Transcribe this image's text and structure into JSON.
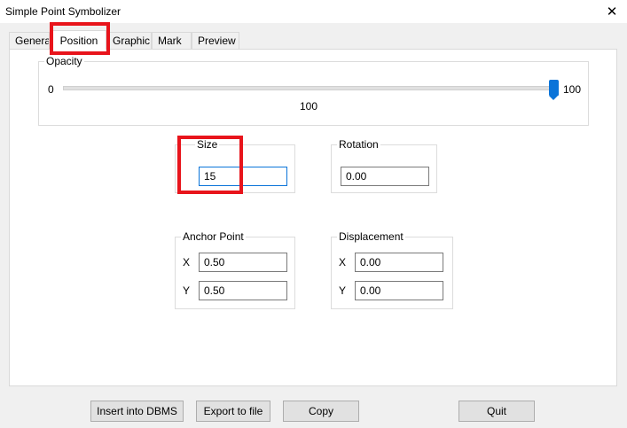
{
  "window": {
    "title": "Simple Point Symbolizer",
    "close_glyph": "✕"
  },
  "tabs": [
    {
      "label": "General"
    },
    {
      "label": "Position"
    },
    {
      "label": "Graphic"
    },
    {
      "label": "Mark"
    },
    {
      "label": "Preview"
    }
  ],
  "opacity": {
    "label": "Opacity",
    "min": "0",
    "max": "100",
    "value": "100",
    "level": 1.0
  },
  "size": {
    "label": "Size",
    "value": "15"
  },
  "rotation": {
    "label": "Rotation",
    "value": "0.00"
  },
  "anchor_point": {
    "label": "Anchor Point",
    "x_label": "X",
    "x_value": "0.50",
    "y_label": "Y",
    "y_value": "0.50"
  },
  "displacement": {
    "label": "Displacement",
    "x_label": "X",
    "x_value": "0.00",
    "y_label": "Y",
    "y_value": "0.00"
  },
  "buttons": {
    "insert": "Insert into DBMS",
    "export": "Export to file",
    "copy": "Copy",
    "quit": "Quit"
  },
  "colors": {
    "accent": "#0a74d9",
    "highlight": "#e8141b"
  }
}
